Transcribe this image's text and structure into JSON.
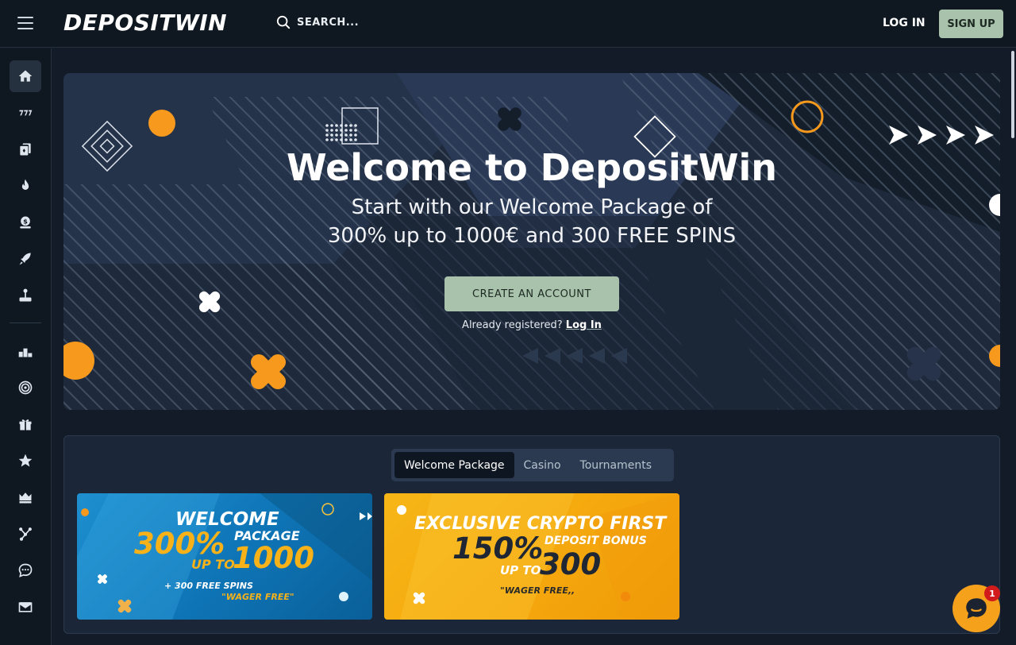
{
  "header": {
    "logo": "DEPOSITWIN",
    "search_label": "SEARCH...",
    "login_label": "LOG IN",
    "signup_label": "SIGN UP"
  },
  "sidebar": {
    "items": [
      {
        "icon": "home-icon",
        "active": true
      },
      {
        "icon": "slots-777-icon"
      },
      {
        "icon": "cards-icon"
      },
      {
        "icon": "fire-icon"
      },
      {
        "icon": "dollar-coin-icon"
      },
      {
        "icon": "rocket-icon"
      },
      {
        "icon": "joystick-icon"
      },
      {
        "icon": "podium-icon"
      },
      {
        "icon": "target-icon"
      },
      {
        "icon": "gift-icon"
      },
      {
        "icon": "star-icon"
      },
      {
        "icon": "crown-icon"
      },
      {
        "icon": "network-icon"
      },
      {
        "icon": "chat-bubble-icon"
      },
      {
        "icon": "mail-icon"
      }
    ]
  },
  "hero": {
    "title": "Welcome to DepositWin",
    "subtitle_line1": "Start with our Welcome Package of",
    "subtitle_line2": "300% up to 1000€ and 300 FREE SPINS",
    "cta_label": "CREATE AN ACCOUNT",
    "already_text": "Already registered?",
    "login_link": "Log In"
  },
  "promotions": {
    "tabs": [
      {
        "label": "Welcome Package",
        "active": true
      },
      {
        "label": "Casino"
      },
      {
        "label": "Tournaments"
      }
    ],
    "cards": [
      {
        "line1": "WELCOME",
        "pct": "300%",
        "package": "PACKAGE",
        "upto": "UP TO",
        "amount": "1000",
        "spins": "+ 300 FREE SPINS",
        "wager": "\"WAGER FREE\""
      },
      {
        "line1": "EXCLUSIVE CRYPTO FIRST",
        "pct": "150%",
        "package": "DEPOSIT BONUS",
        "upto": "UP TO",
        "amount": "300",
        "wager": "\"WAGER FREE,,"
      }
    ]
  },
  "chat": {
    "badge": "1"
  },
  "colors": {
    "accent_green": "#a9c2ac",
    "orange": "#f6a11b",
    "background": "#121b27"
  }
}
